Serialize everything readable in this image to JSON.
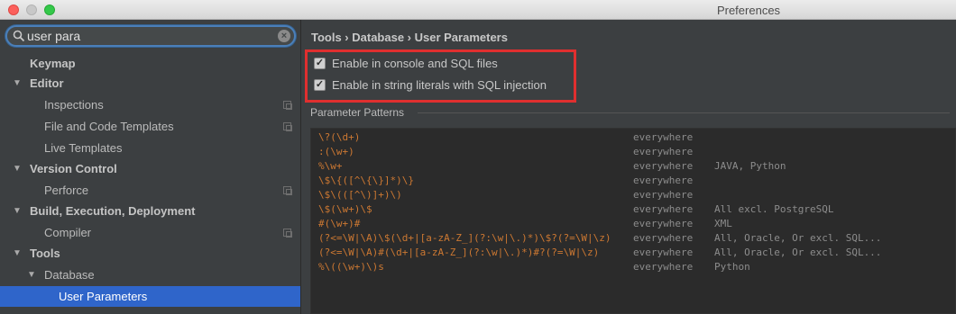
{
  "window": {
    "title": "Preferences"
  },
  "search": {
    "value": "user para"
  },
  "sidebar": {
    "items": [
      {
        "label": "Keymap"
      },
      {
        "label": "Editor"
      },
      {
        "label": "Inspections"
      },
      {
        "label": "File and Code Templates"
      },
      {
        "label": "Live Templates"
      },
      {
        "label": "Version Control"
      },
      {
        "label": "Perforce"
      },
      {
        "label": "Build, Execution, Deployment"
      },
      {
        "label": "Compiler"
      },
      {
        "label": "Tools"
      },
      {
        "label": "Database"
      },
      {
        "label": "User Parameters"
      }
    ]
  },
  "main": {
    "breadcrumb": "Tools › Database › User Parameters",
    "options": [
      {
        "label": "Enable in console and SQL files",
        "checked": true
      },
      {
        "label": "Enable in string literals with SQL injection",
        "checked": true
      }
    ],
    "section_title": "Parameter Patterns",
    "patterns": [
      {
        "pattern": "\\?(\\d+)",
        "scope": "everywhere",
        "dialect": ""
      },
      {
        "pattern": ":(\\w+)",
        "scope": "everywhere",
        "dialect": ""
      },
      {
        "pattern": "%\\w+",
        "scope": "everywhere",
        "dialect": "JAVA, Python"
      },
      {
        "pattern": "\\$\\{([^\\{\\}]*)\\}",
        "scope": "everywhere",
        "dialect": ""
      },
      {
        "pattern": "\\$\\(([^\\)]+)\\)",
        "scope": "everywhere",
        "dialect": ""
      },
      {
        "pattern": "\\$(\\w+)\\$",
        "scope": "everywhere",
        "dialect": "All excl. PostgreSQL"
      },
      {
        "pattern": "#(\\w+)#",
        "scope": "everywhere",
        "dialect": "XML"
      },
      {
        "pattern": "(?<=\\W|\\A)\\$(\\d+|[a-zA-Z_](?:\\w|\\.)*)\\$?(?=\\W|\\z)",
        "scope": "everywhere",
        "dialect": "All, Oracle, Or excl. SQL..."
      },
      {
        "pattern": "(?<=\\W|\\A)#(\\d+|[a-zA-Z_](?:\\w|\\.)*)#?(?=\\W|\\z)",
        "scope": "everywhere",
        "dialect": "All, Oracle, Or excl. SQL..."
      },
      {
        "pattern": "%\\((\\w+)\\)s",
        "scope": "everywhere",
        "dialect": "Python"
      }
    ]
  },
  "colors": {
    "selection": "#2f65ca",
    "highlight_box": "#e02f2f",
    "pattern_text": "#cc7832"
  }
}
